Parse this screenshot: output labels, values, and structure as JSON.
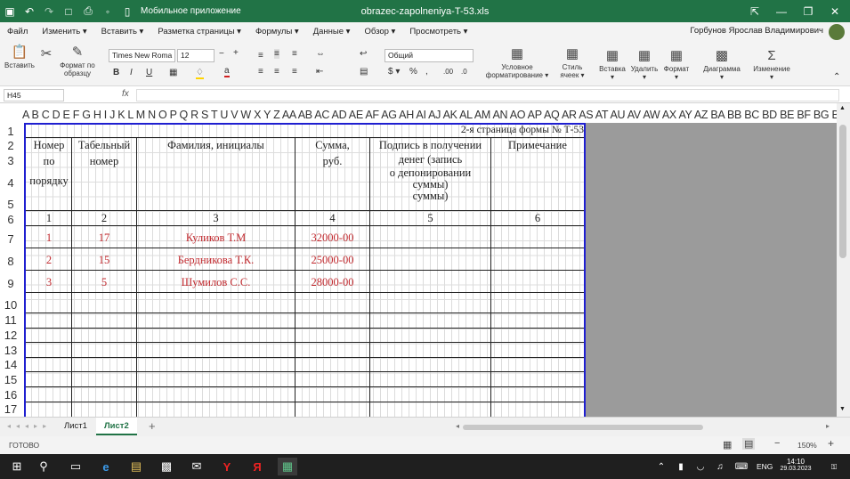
{
  "titlebar": {
    "app_label": "Мобильное приложение",
    "file": "obrazec-zapolneniya-T-53.xls"
  },
  "menu": [
    "Файл",
    "Изменить",
    "Вставить",
    "Разметка страницы",
    "Формулы",
    "Данные",
    "Обзор",
    "Просмотреть"
  ],
  "user": "Горбунов Ярослав Владимирович",
  "ribbon": {
    "paste": "Вставить",
    "format_painter": "Формат по образцу",
    "font_name": "Times New Roma",
    "font_size": "12",
    "number_format": "Общий",
    "cond_format": "Условное форматирование",
    "cell_style": "Стиль ячеек",
    "insert": "Вставка",
    "delete": "Удалить",
    "format": "Формат",
    "chart": "Диаграмма",
    "changes": "Изменение"
  },
  "formula": {
    "cell_ref": "H45",
    "fx": "fx",
    "value": ""
  },
  "columns": "A B C D E F G H I J K L M N O P Q R S T U V W X Y Z AA AB AC AD AE AF AG AH AI AJ AK AL AM AN AO AP AQ AR AS AT AU AV AW AX AY AZ BA BB BC BD BE BF BG BH BI BJ BK BL BM BN BO BP BQ BR BS BT BU BV BW BX BY BZ CA CB CC CD CE CF CG CH",
  "rows": [
    "1",
    "2",
    "3",
    "4",
    "5",
    "6",
    "7",
    "8",
    "9",
    "10",
    "11",
    "12",
    "13",
    "14",
    "15",
    "16",
    "17"
  ],
  "doc": {
    "page_note": "2-я страница формы № Т-53",
    "h_num": [
      "Номер",
      "по",
      "порядку"
    ],
    "h_tab": [
      "Табельный",
      "номер"
    ],
    "h_name": "Фамилия, инициалы",
    "h_sum": [
      "Сумма,",
      "руб."
    ],
    "h_sign": [
      "Подпись в получении",
      "денег (запись",
      "о депонировании",
      "суммы)",
      "суммы)"
    ],
    "h_note": "Примечание",
    "col_numbers": [
      "1",
      "2",
      "3",
      "4",
      "5",
      "6"
    ],
    "entries": [
      {
        "n": "1",
        "tab": "17",
        "name": "Куликов Т.М",
        "sum": "32000-00"
      },
      {
        "n": "2",
        "tab": "15",
        "name": "Бердникова Т.К.",
        "sum": "25000-00"
      },
      {
        "n": "3",
        "tab": "5",
        "name": "Шумилов С.С.",
        "sum": "28000-00"
      }
    ]
  },
  "sheets": [
    "Лист1",
    "Лист2"
  ],
  "status": {
    "ready": "ГОТОВО",
    "zoom": "150%"
  },
  "taskbar": {
    "lang": "ENG",
    "time": "14:10",
    "date": "29.03.2023",
    "notif": "1"
  },
  "colors": {
    "accent": "#217346",
    "frame": "#1f1fd0",
    "red_text": "#c0282d"
  }
}
